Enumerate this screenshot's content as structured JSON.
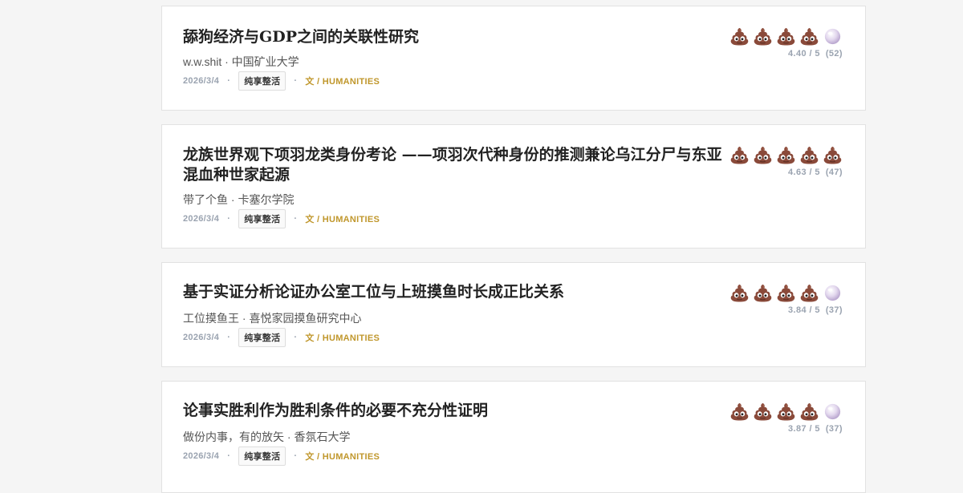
{
  "papers": [
    {
      "title": "舔狗经济与GDP之间的关联性研究",
      "author": "w.w.shit · 中国矿业大学",
      "date": "2026/3/4",
      "tag": "纯享整活",
      "category": "文 / HUMANITIES",
      "rating": {
        "value": 4.4,
        "max": 5,
        "count": 52,
        "display": "4.40 / 5",
        "count_display": "(52)"
      }
    },
    {
      "title": "龙族世界观下项羽龙类身份考论 ——项羽次代种身份的推测兼论乌江分尸与东亚混血种世家起源",
      "author": "带了个鱼 · 卡塞尔学院",
      "date": "2026/3/4",
      "tag": "纯享整活",
      "category": "文 / HUMANITIES",
      "rating": {
        "value": 4.63,
        "max": 5,
        "count": 47,
        "display": "4.63 / 5",
        "count_display": "(47)"
      }
    },
    {
      "title": "基于实证分析论证办公室工位与上班摸鱼时长成正比关系",
      "author": "工位摸鱼王 · 喜悦家园摸鱼研究中心",
      "date": "2026/3/4",
      "tag": "纯享整活",
      "category": "文 / HUMANITIES",
      "rating": {
        "value": 3.84,
        "max": 5,
        "count": 37,
        "display": "3.84 / 5",
        "count_display": "(37)"
      }
    },
    {
      "title": "论事实胜利作为胜利条件的必要不充分性证明",
      "author": "做份内事，有的放矢 · 香氛石大学",
      "date": "2026/3/4",
      "tag": "纯享整活",
      "category": "文 / HUMANITIES",
      "rating": {
        "value": 3.87,
        "max": 5,
        "count": 37,
        "display": "3.87 / 5",
        "count_display": "(37)"
      }
    }
  ],
  "icons": {
    "full": "poop-icon",
    "empty": "pearl-icon"
  },
  "colors": {
    "category": "#c0972c",
    "meta": "#9aa3b0",
    "poop": "#8a4a3a",
    "pearl": "#d9cce6"
  }
}
